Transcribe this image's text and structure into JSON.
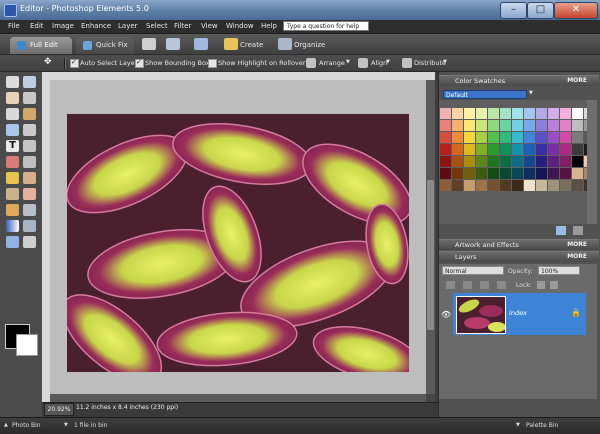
{
  "window": {
    "title": "Editor - Photoshop Elements 5.0",
    "controls": {
      "minimize": "–",
      "maximize": "□",
      "close": "✕"
    }
  },
  "menubar": {
    "items": [
      "File",
      "Edit",
      "Image",
      "Enhance",
      "Layer",
      "Select",
      "Filter",
      "View",
      "Window",
      "Help"
    ],
    "help_placeholder": "Type a question for help"
  },
  "modebar": {
    "full_edit": "Full Edit",
    "quick_fix": "Quick Fix",
    "create": "Create",
    "organize": "Organize"
  },
  "options": {
    "auto_select_layer": {
      "label": "Auto Select Layer",
      "checked": true
    },
    "show_bounding_box": {
      "label": "Show Bounding Box",
      "checked": true
    },
    "show_highlight": {
      "label": "Show Highlight on Rollover",
      "checked": false
    },
    "arrange": "Arrange",
    "align": "Align",
    "distribute": "Distribute"
  },
  "status": {
    "zoom": "20.92%",
    "doc_size": "11.2 inches x 8.4 inches (230 ppi)"
  },
  "panels": {
    "color_swatches": {
      "title": "Color Swatches",
      "more": "MORE",
      "preset": "Default"
    },
    "artwork": {
      "title": "Artwork and Effects",
      "more": "MORE"
    },
    "layers": {
      "title": "Layers",
      "more": "MORE",
      "blend_mode": "Normal",
      "opacity_label": "Opacity:",
      "opacity_value": "100%",
      "lock_label": "Lock:",
      "layer_name": "Index"
    }
  },
  "bottombar": {
    "photo_bin": "Photo Bin",
    "files_in_bin": "1 file in bin",
    "palette_bin": "Palette Bin"
  },
  "swatch_colors": [
    "#f2b1b1",
    "#fbd3a5",
    "#fff1a6",
    "#e7f2a6",
    "#b9e7a8",
    "#a4e4c6",
    "#a1e3ec",
    "#a3c6ef",
    "#b3a9e6",
    "#d2aee8",
    "#f2b0da",
    "#ffffff",
    "#d9d9d9",
    "#e9807a",
    "#f7b16e",
    "#fbe872",
    "#cbe77a",
    "#8fd67d",
    "#6dd3a6",
    "#6fd1e2",
    "#78a9e7",
    "#8c7fd9",
    "#b97fd9",
    "#e57fc3",
    "#bdbdbd",
    "#9a9a9a",
    "#d94a3f",
    "#ee8a3a",
    "#f6d73a",
    "#a8d042",
    "#55bf4a",
    "#32bb80",
    "#38b9d3",
    "#4185da",
    "#5c4fc8",
    "#9a4fc8",
    "#d14ba6",
    "#7a7a7a",
    "#595959",
    "#b91f1f",
    "#d4671a",
    "#dcb91a",
    "#7fb023",
    "#2e9a2b",
    "#138f5d",
    "#1590ad",
    "#1e5fb7",
    "#3a2ea5",
    "#7a2ea5",
    "#ad2883",
    "#3b3b3b",
    "#1b1b1b",
    "#8f1313",
    "#a9500f",
    "#a98d10",
    "#5c8718",
    "#1f7520",
    "#0c6d46",
    "#0e6d85",
    "#154790",
    "#271f7e",
    "#5c1f7e",
    "#851c63",
    "#000000",
    "#f6c6a6",
    "#5f0c0c",
    "#723609",
    "#725f0b",
    "#3e5a10",
    "#134c15",
    "#07482e",
    "#084758",
    "#0d2f60",
    "#191454",
    "#3e1454",
    "#581242",
    "#d9b38c",
    "#b38660",
    "#8c5f3a",
    "#5f3f26",
    "#c69c6d",
    "#9c7347",
    "#735230",
    "#523a21",
    "#3b2a18",
    "#f0e2c8",
    "#c7b89a",
    "#a0937a",
    "#7a6f5c",
    "#5a5246",
    "#3a342c"
  ]
}
